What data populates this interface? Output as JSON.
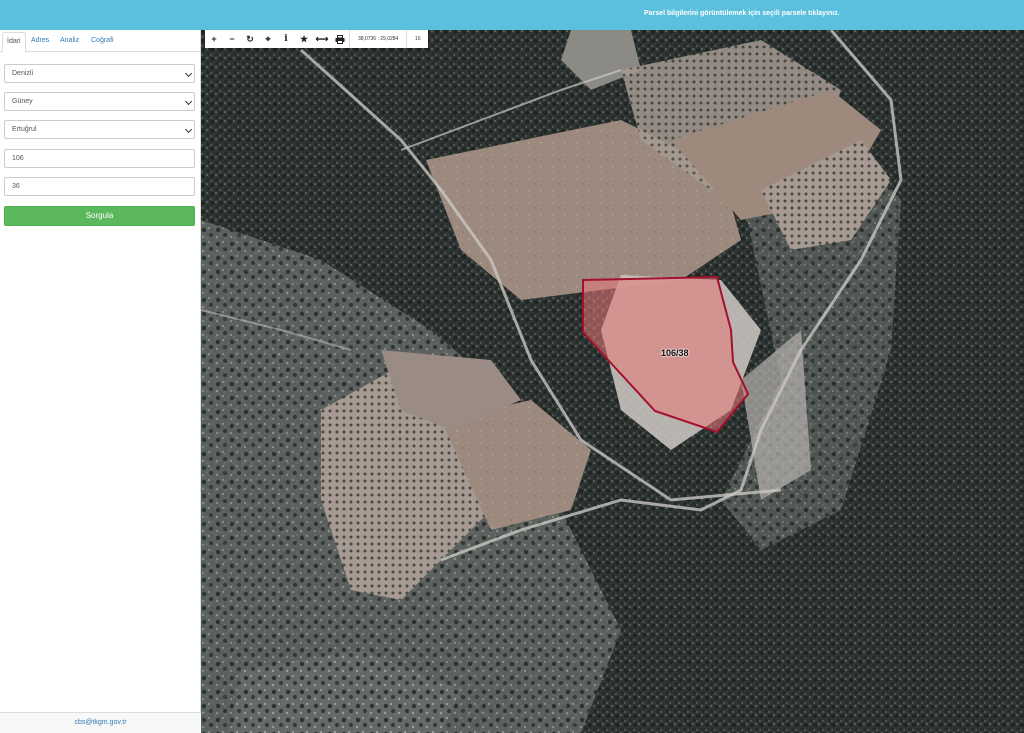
{
  "header": {
    "message": "Parsel bilgilerini görüntülemek için seçili parsele tıklayınız."
  },
  "sidebar": {
    "tabs": [
      "İdari",
      "Adres",
      "Analiz",
      "Coğrafi"
    ],
    "active_tab": "İdari",
    "fields": {
      "il": "Denizli",
      "ilce": "Güney",
      "mahalle": "Ertuğrul",
      "ada": "106",
      "parsel": "36"
    },
    "query_button": "Sorgula",
    "footer_email": "cbs@tkgm.gov.tr"
  },
  "toolbar": {
    "icons": [
      "plus-icon",
      "minus-icon",
      "refresh-icon",
      "crosshair-icon",
      "info-icon",
      "star-icon",
      "measure-icon",
      "print-icon"
    ],
    "coordinates": "38,0736 : 29,0284",
    "zoom_level": "16"
  },
  "map": {
    "parcel_label": "106/38",
    "parcel_fill": "#e87878",
    "parcel_stroke": "#a3112e"
  },
  "colors": {
    "topbar": "#5bc0de",
    "button": "#5cb85c"
  }
}
